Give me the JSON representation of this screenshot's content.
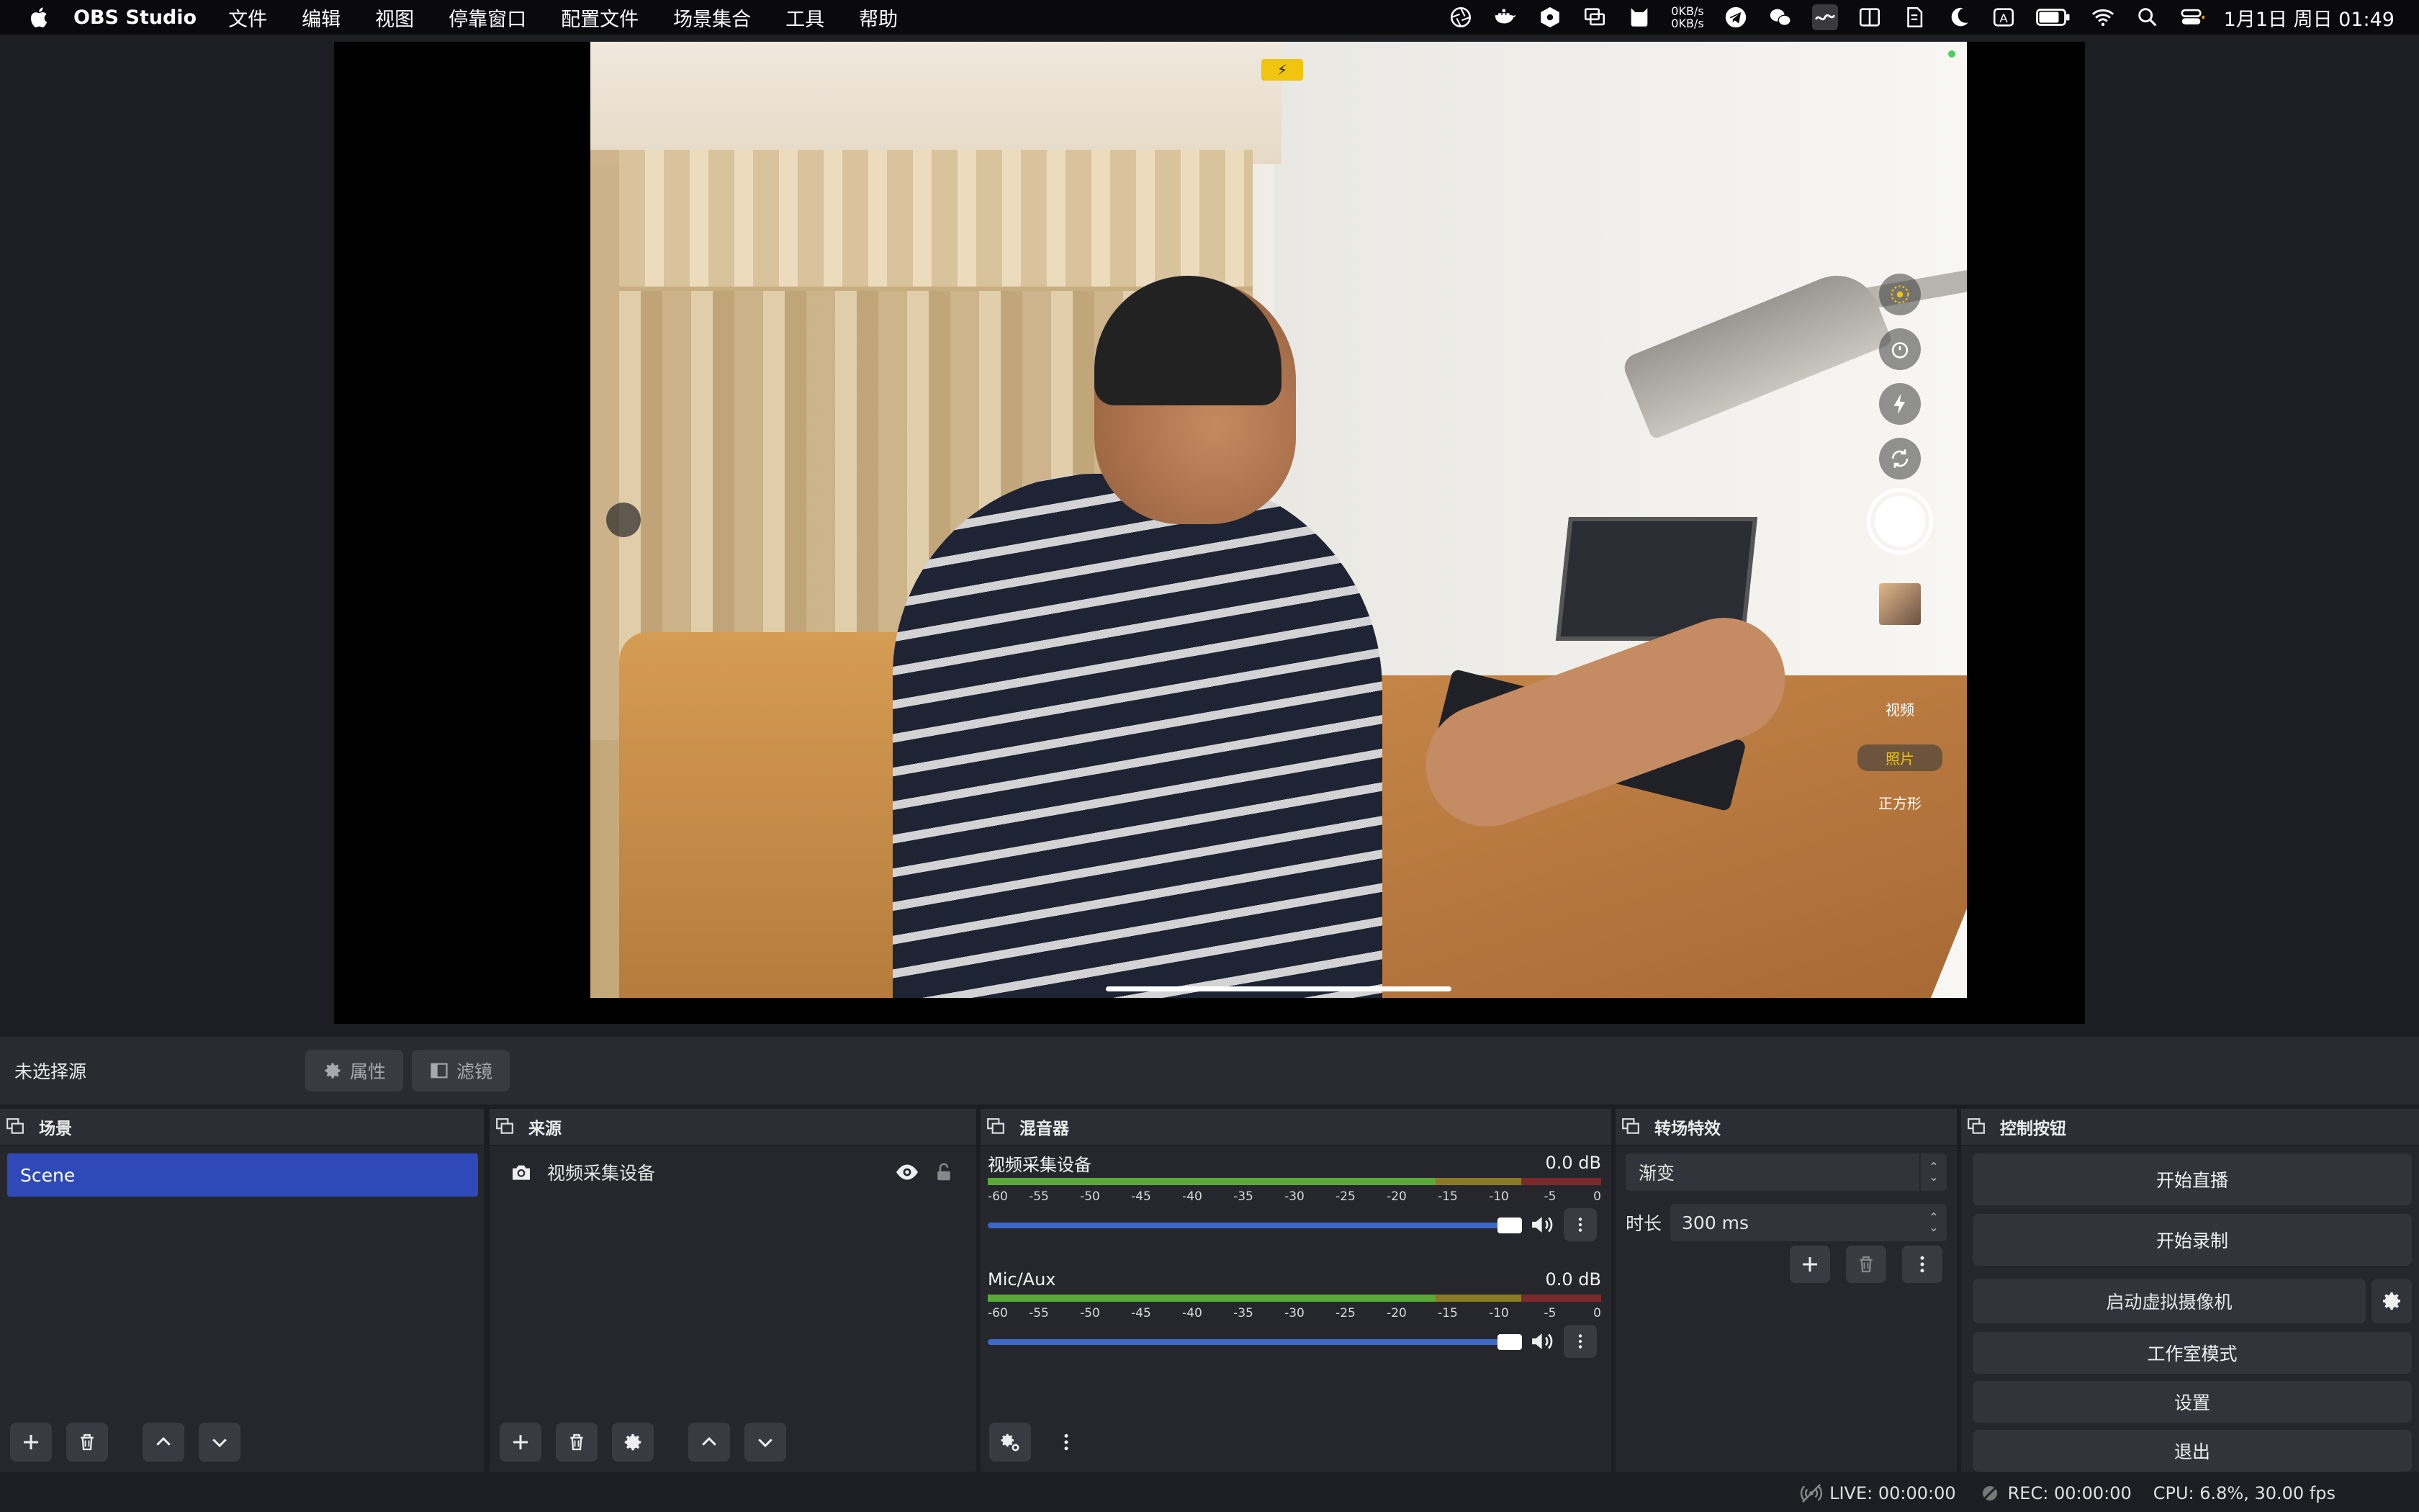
{
  "menubar": {
    "app_name": "OBS Studio",
    "menus": [
      "文件",
      "编辑",
      "视图",
      "停靠窗口",
      "配置文件",
      "场景集合",
      "工具",
      "帮助"
    ],
    "net_up": "0KB/s",
    "net_down": "0KB/s",
    "input_source": "A",
    "clock": "1月1日 周日 01:49",
    "status_icons": [
      "aperture-icon",
      "docker-icon",
      "hexagon-icon",
      "screen-share-icon",
      "cat-icon",
      "network-speed",
      "telegram-icon",
      "wechat-icon",
      "wave-icon",
      "split-view-icon",
      "note-icon",
      "moon-icon",
      "input-source-icon",
      "battery-icon",
      "wifi-icon",
      "spotlight-icon",
      "control-center-icon"
    ]
  },
  "preview": {
    "camera_modes": [
      "视频",
      "照片",
      "正方形"
    ],
    "active_mode": "照片"
  },
  "source_toolbar": {
    "no_source": "未选择源",
    "properties_label": "属性",
    "filters_label": "滤镜"
  },
  "docks": {
    "scenes": {
      "title": "场景",
      "items": [
        "Scene"
      ]
    },
    "sources": {
      "title": "来源",
      "items": [
        "视频采集设备"
      ]
    },
    "mixer": {
      "title": "混音器",
      "ticks": [
        "-60",
        "-55",
        "-50",
        "-45",
        "-40",
        "-35",
        "-30",
        "-25",
        "-20",
        "-15",
        "-10",
        "-5",
        "0"
      ],
      "channels": [
        {
          "name": "视频采集设备",
          "db": "0.0 dB",
          "volume": 1.0
        },
        {
          "name": "Mic/Aux",
          "db": "0.0 dB",
          "volume": 1.0
        }
      ]
    },
    "transitions": {
      "title": "转场特效",
      "selected": "渐变",
      "duration_label": "时长",
      "duration_value": "300 ms"
    },
    "controls": {
      "title": "控制按钮",
      "start_stream": "开始直播",
      "start_record": "开始录制",
      "virtual_cam": "启动虚拟摄像机",
      "studio_mode": "工作室模式",
      "settings": "设置",
      "exit": "退出"
    }
  },
  "statusbar": {
    "live": "LIVE: 00:00:00",
    "rec": "REC: 00:00:00",
    "cpu": "CPU: 6.8%, 30.00 fps"
  },
  "colors": {
    "accent": "#2f4ab8",
    "fader": "#3a69c9",
    "background": "#1d1e23"
  }
}
